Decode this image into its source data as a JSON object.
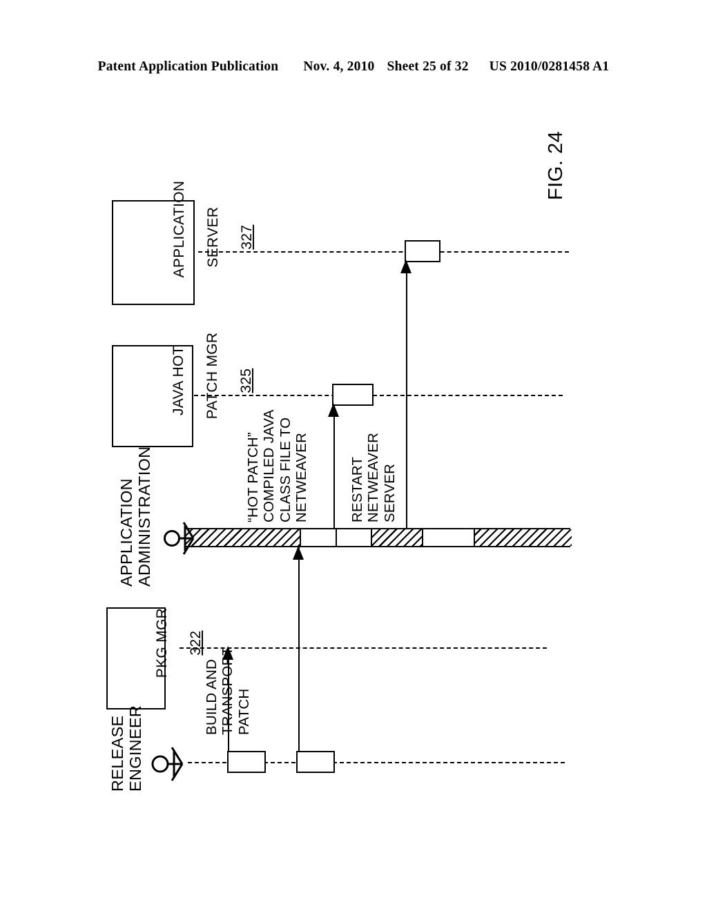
{
  "header": {
    "publication": "Patent Application Publication",
    "date": "Nov. 4, 2010",
    "sheet": "Sheet 25 of 32",
    "patent_number": "US 2010/0281458 A1"
  },
  "figure": {
    "label": "FIG. 24",
    "type": "uml-sequence-diagram"
  },
  "participants": [
    {
      "id": "application-server",
      "name_line1": "APPLICATION",
      "name_line2": "SERVER",
      "ref": "327",
      "lifeline_style": "dashed"
    },
    {
      "id": "java-hot-patch-mgr",
      "name_line1": "JAVA HOT",
      "name_line2": "PATCH MGR",
      "ref": "325",
      "lifeline_style": "dashed"
    },
    {
      "id": "pkg-mgr",
      "name_line1": "PKG MGR",
      "name_line2": "",
      "ref": "322",
      "lifeline_style": "dashed"
    }
  ],
  "actors": [
    {
      "id": "application-administration",
      "name_line1": "APPLICATION",
      "name_line2": "ADMINISTRATION",
      "lifeline_style": "hatched-band"
    },
    {
      "id": "release-engineer",
      "name_line1": "RELEASE",
      "name_line2": "ENGINEER",
      "lifeline_style": "dashed"
    }
  ],
  "messages": [
    {
      "id": "build-and-transport-patch",
      "lines": [
        "BUILD AND",
        "TRANSPORT",
        "PATCH"
      ],
      "from": "release-engineer",
      "to": "pkg-mgr",
      "direction": "up"
    },
    {
      "id": "hot-patch-compiled-java-class-file-to-netweaver",
      "lines": [
        "“HOT PATCH”",
        "COMPILED JAVA",
        "CLASS FILE TO",
        "NETWEAVER"
      ],
      "from": "release-engineer",
      "to": "application-administration",
      "direction": "up"
    },
    {
      "id": "restart-netweaver-server",
      "lines": [
        "RESTART",
        "NETWEAVER",
        "SERVER"
      ],
      "from": "application-administration",
      "to": "java-hot-patch-mgr",
      "direction": "up"
    },
    {
      "id": "restart-application-server",
      "lines": [],
      "from": "application-administration",
      "to": "application-server",
      "direction": "up"
    }
  ],
  "colors": {
    "ink": "#000000",
    "paper": "#ffffff"
  }
}
